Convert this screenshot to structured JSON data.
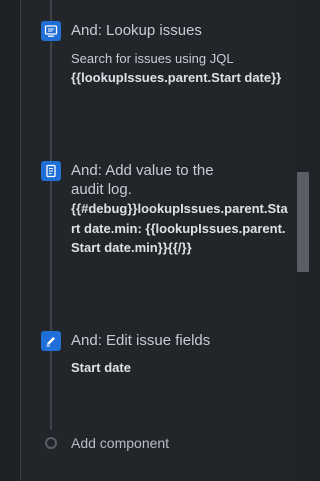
{
  "steps": [
    {
      "icon": "monitor-search-icon",
      "title": "And: Lookup issues",
      "subtitle": "Search for issues using JQL",
      "code": "{{lookupIssues.parent.Start date}}"
    },
    {
      "icon": "audit-log-icon",
      "title": "And: Add value to the audit log.",
      "code": "{{#debug}}lookupIssues.parent.Start date.min: {{lookupIssues.parent.Start date.min}}{{/}}"
    },
    {
      "icon": "pencil-icon",
      "title": "And: Edit issue fields",
      "code": "Start date"
    }
  ],
  "add_component": {
    "label": "Add component"
  },
  "colors": {
    "accent": "#1f6fd6",
    "background": "#22262b",
    "text": "#c7ccd3"
  }
}
